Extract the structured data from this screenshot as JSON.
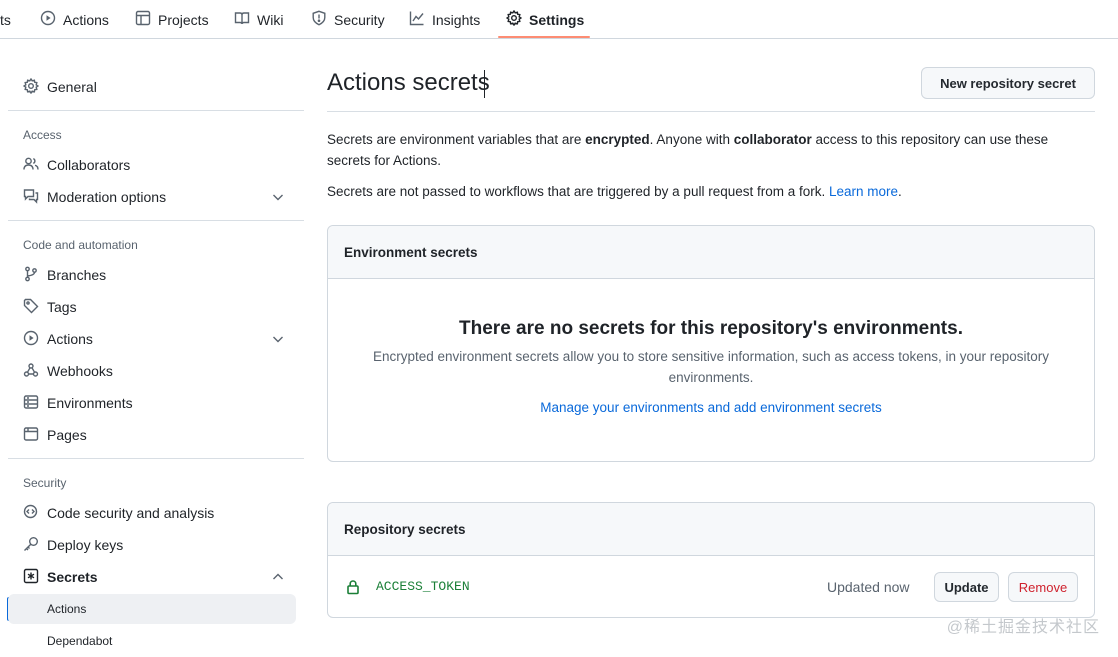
{
  "topnav": {
    "tabs": [
      {
        "label": "ts",
        "icon": ""
      },
      {
        "label": "Actions",
        "icon": "play-circle-icon"
      },
      {
        "label": "Projects",
        "icon": "table-icon"
      },
      {
        "label": "Wiki",
        "icon": "book-icon"
      },
      {
        "label": "Security",
        "icon": "shield-icon"
      },
      {
        "label": "Insights",
        "icon": "graph-icon"
      },
      {
        "label": "Settings",
        "icon": "gear-icon",
        "selected": true
      }
    ],
    "accent_color": "#fd8c73"
  },
  "sidebar": {
    "general": "General",
    "sections": {
      "access": "Access",
      "code_automation": "Code and automation",
      "security": "Security"
    },
    "items": {
      "collaborators": "Collaborators",
      "moderation": "Moderation options",
      "branches": "Branches",
      "tags": "Tags",
      "actions": "Actions",
      "webhooks": "Webhooks",
      "environments": "Environments",
      "pages": "Pages",
      "code_security": "Code security and analysis",
      "deploy_keys": "Deploy keys",
      "secrets": "Secrets",
      "secrets_actions": "Actions",
      "secrets_dependabot": "Dependabot"
    }
  },
  "main": {
    "title": "Actions secrets",
    "new_secret_button": "New repository secret",
    "intro": {
      "p1_a": "Secrets are environment variables that are ",
      "p1_b": "encrypted",
      "p1_c": ". Anyone with ",
      "p1_d": "collaborator",
      "p1_e": " access to this repository can use these secrets for Actions.",
      "p2": "Secrets are not passed to workflows that are triggered by a pull request from a fork. ",
      "p2_link": "Learn more"
    },
    "env_secrets": {
      "header": "Environment secrets",
      "empty_title": "There are no secrets for this repository's environments.",
      "empty_desc": "Encrypted environment secrets allow you to store sensitive information, such as access tokens, in your repository environments.",
      "manage_link": "Manage your environments and add environment secrets"
    },
    "repo_secrets": {
      "header": "Repository secrets",
      "rows": [
        {
          "name": "ACCESS_TOKEN",
          "updated": "Updated now",
          "update_label": "Update",
          "remove_label": "Remove"
        }
      ]
    }
  },
  "watermark": "@稀土掘金技术社区"
}
